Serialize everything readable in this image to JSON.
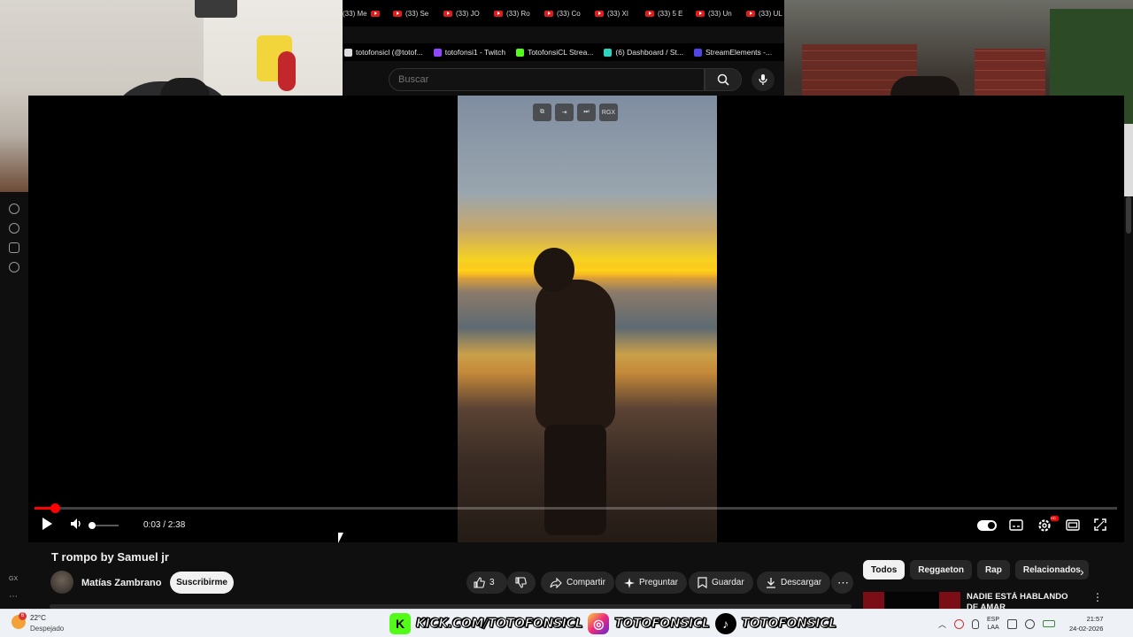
{
  "browser": {
    "tabs": [
      "(33) Me",
      "(33) Se",
      "(33) JO",
      "(33) Ro",
      "(33) Co",
      "(33) XI",
      "(33) 5 E",
      "(33) Un",
      "(33) UL"
    ],
    "bookmarks": [
      {
        "label": "totofonsicl (@totof...",
        "color": "#dddddd"
      },
      {
        "label": "totofonsi1 - Twitch",
        "color": "#9146ff"
      },
      {
        "label": "TotofonsiCL Strea...",
        "color": "#53fc18"
      },
      {
        "label": "(6) Dashboard / St...",
        "color": "#2dd4bf"
      },
      {
        "label": "StreamElements -...",
        "color": "#4f46e5"
      }
    ]
  },
  "search": {
    "placeholder": "Buscar"
  },
  "player": {
    "overlay_label": "RGX",
    "time_display": "0:03 / 2:38",
    "progress_fraction": 0.019,
    "volume_fraction": 0.0,
    "hd_badge": "HD",
    "accent": "#ff0000"
  },
  "video": {
    "title": "T rompo by Samuel jr",
    "channel": "Matías Zambrano",
    "subscribe_label": "Suscribirme",
    "likes": "3",
    "share_label": "Compartir",
    "ask_label": "Preguntar",
    "save_label": "Guardar",
    "download_label": "Descargar"
  },
  "sidebar": {
    "gx_label": "GX"
  },
  "chips": [
    "Todos",
    "Reggaeton",
    "Rap",
    "Relacionados"
  ],
  "recommendation": {
    "title": "NADIE ESTÁ HABLANDO DE AMAR"
  },
  "taskbar": {
    "weather_badge": "6",
    "temperature": "22°C",
    "weather": "Despejado",
    "promo": [
      "KICK.COM/TOTOFONSICL",
      "TOTOFONSICL",
      "TOTOFONSICL"
    ],
    "lang_1": "ESP",
    "lang_2": "LAA",
    "time": "21:57",
    "date": "24-02-2026"
  }
}
